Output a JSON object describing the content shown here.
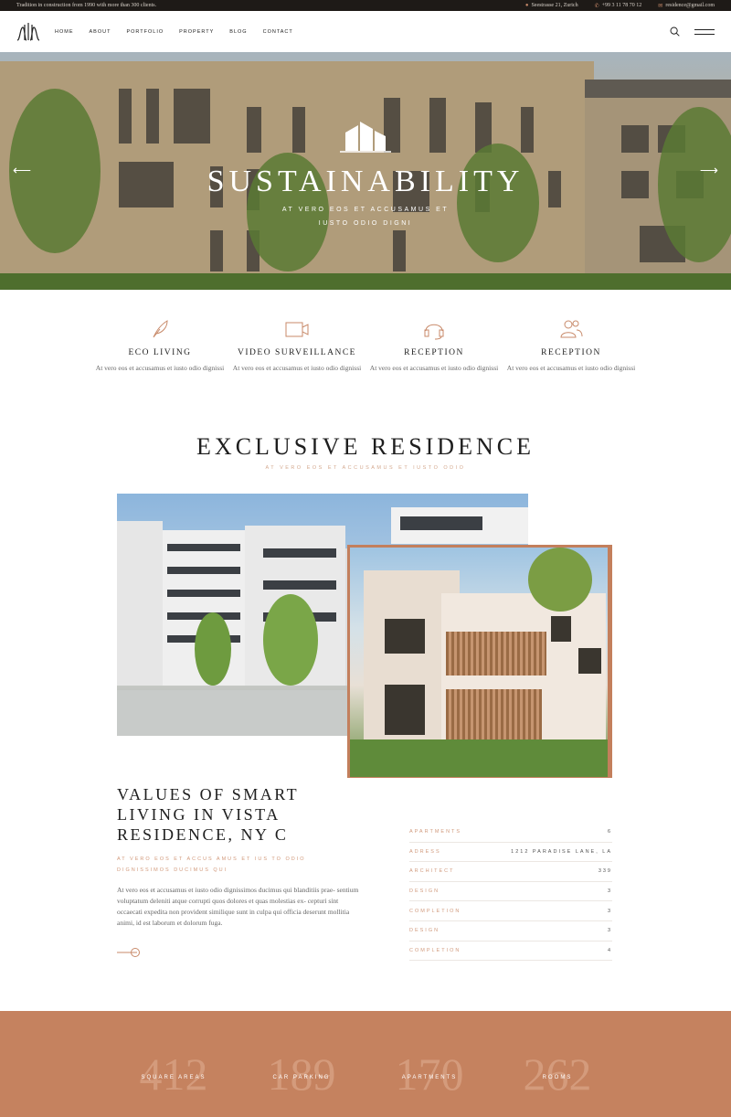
{
  "topbar": {
    "tagline": "Tradition in construction from 1990 with more than 300 clients.",
    "address": "Seestrasse 21, Zurich",
    "phone": "+99 3 11 78 70 12",
    "email": "residence@gmail.com"
  },
  "nav": {
    "items": [
      "HOME",
      "ABOUT",
      "PORTFOLIO",
      "PROPERTY",
      "BLOG",
      "CONTACT"
    ]
  },
  "hero": {
    "title": "SUSTAINABILITY",
    "subtitle_line1": "AT VERO EOS ET ACCUSAMUS ET",
    "subtitle_line2": "IUSTO ODIO DIGNI"
  },
  "features": [
    {
      "icon": "feather-icon",
      "title": "ECO LIVING",
      "text": "At vero eos et accusamus et iusto odio dignissi"
    },
    {
      "icon": "camera-icon",
      "title": "VIDEO SURVEILLANCE",
      "text": "At vero eos et accusamus et iusto odio dignissi"
    },
    {
      "icon": "headset-icon",
      "title": "RECEPTION",
      "text": "At vero eos et accusamus et iusto odio dignissi"
    },
    {
      "icon": "users-icon",
      "title": "RECEPTION",
      "text": "At vero eos et accusamus et iusto odio dignissi"
    }
  ],
  "exclusive": {
    "title": "EXCLUSIVE RESIDENCE",
    "subtitle": "AT VERO EOS ET ACCUSAMUS ET IUSTO ODIO"
  },
  "values": {
    "title": "VALUES OF SMART LIVING IN VISTA RESIDENCE, NY C",
    "subtitle": "AT VERO EOS ET ACCUS AMUS ET IUS TO ODIO DIGNISSIMOS DUCIMUS QUI",
    "text": "At vero eos et accusamus et iusto odio dignissimos ducimus qui blanditiis prae- sentium voluptatum deleniti atque corrupti quos dolores et quas molestias ex- cepturi sint occaecati expedita non provident similique sunt in culpa qui officia deserunt mollitia animi, id est laborum et dolorum fuga."
  },
  "specs": [
    {
      "key": "APARTMENTS",
      "value": "6"
    },
    {
      "key": "ADRESS",
      "value": "1212 PARADISE LANE, LA"
    },
    {
      "key": "ARCHITECT",
      "value": "339"
    },
    {
      "key": "DESIGN",
      "value": "3"
    },
    {
      "key": "COMPLETION",
      "value": "3"
    },
    {
      "key": "DESIGN",
      "value": "3"
    },
    {
      "key": "COMPLETION",
      "value": "4"
    }
  ],
  "stats": [
    {
      "number": "412",
      "label": "SQUARE AREAS"
    },
    {
      "number": "189",
      "label": "CAR PARKING"
    },
    {
      "number": "170",
      "label": "APARTMENTS"
    },
    {
      "number": "262",
      "label": "ROOMS"
    }
  ],
  "colors": {
    "accent": "#c5825f",
    "accent_light": "#d29a7c",
    "dark": "#1e1a17"
  }
}
